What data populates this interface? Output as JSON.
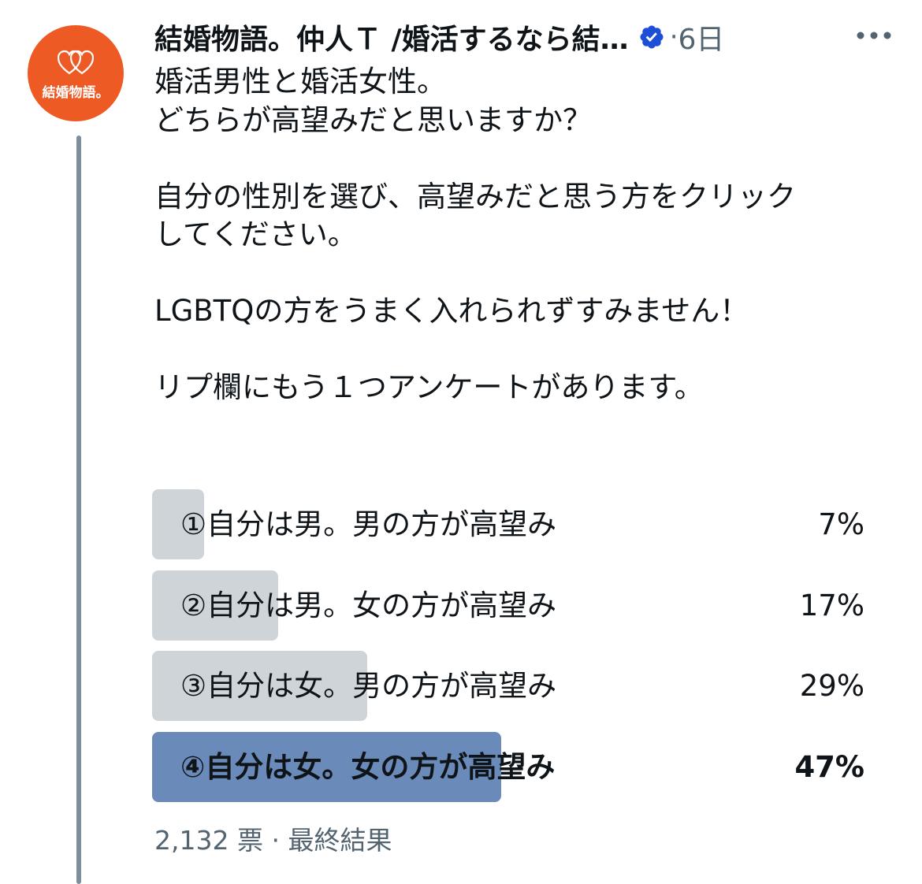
{
  "avatar": {
    "icon": "double-heart-icon",
    "text": "結婚物語。",
    "color": "#ee5a24"
  },
  "tweet": {
    "author_name": "結婚物語。仲人Ｔ /婚活するなら結…",
    "verified": true,
    "verified_icon": "verified-badge-icon",
    "separator": "·",
    "time": "6日",
    "more_icon": "more-options-icon",
    "body_lines": [
      "婚活男性と婚活女性。",
      "どちらが高望みだと思いますか？",
      "",
      "自分の性別を選び、高望みだと思う方をクリック",
      "してください。",
      "",
      "LGBTQの方をうまく入れられずすみません！",
      "",
      "リプ欄にもう１つアンケートがあります。"
    ]
  },
  "poll": {
    "options": [
      {
        "label": "①自分は男。男の方が高望み",
        "percent": "7%",
        "value": 7,
        "winner": false
      },
      {
        "label": "②自分は男。女の方が高望み",
        "percent": "17%",
        "value": 17,
        "winner": false
      },
      {
        "label": "③自分は女。男の方が高望み",
        "percent": "29%",
        "value": 29,
        "winner": false
      },
      {
        "label": "④自分は女。女の方が高望み",
        "percent": "47%",
        "value": 47,
        "winner": true
      }
    ],
    "votes": "2,132 票",
    "separator": "·",
    "status": "最終結果",
    "colors": {
      "bar": "#cfd4d8",
      "winner_bar": "#6a8bb9"
    }
  }
}
